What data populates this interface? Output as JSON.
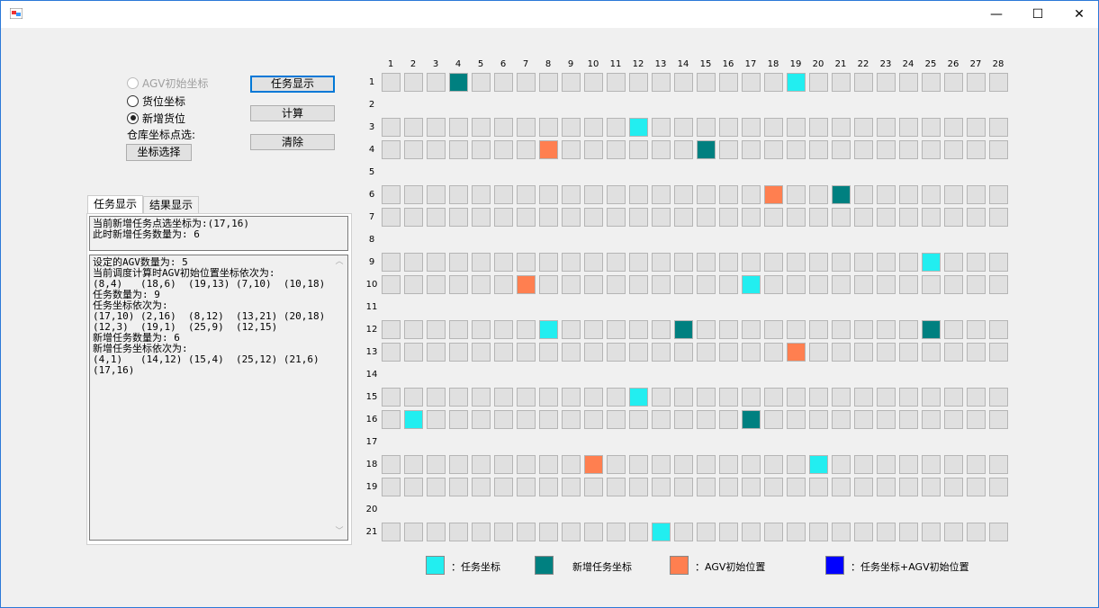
{
  "window": {
    "minimize": "—",
    "maximize": "☐",
    "close": "✕"
  },
  "controls": {
    "radio_agv": "AGV初始坐标",
    "radio_slot": "货位坐标",
    "radio_new": "新增货位",
    "warehouse_label": "仓库坐标点选:",
    "coord_select": "坐标选择",
    "btn_show": "任务显示",
    "btn_calc": "计算",
    "btn_clear": "清除"
  },
  "tabs": [
    "任务显示",
    "结果显示"
  ],
  "info_text": "当前新增任务点选坐标为:(17,16)\n此时新增任务数量为: 6",
  "log_text": "设定的AGV数量为: 5\n当前调度计算时AGV初始位置坐标依次为:\n(8,4)   (18,6)  (19,13) (7,10)  (10,18)\n任务数量为: 9\n任务坐标依次为:\n(17,10) (2,16)  (8,12)  (13,21) (20,18)\n(12,3)  (19,1)  (25,9)  (12,15)\n新增任务数量为: 6\n新增任务坐标依次为:\n(4,1)   (14,12) (15,4)  (25,12) (21,6)\n(17,16)",
  "grid": {
    "cols": 28,
    "rows": 21,
    "empty_rows": [
      2,
      5,
      8,
      11,
      14,
      17,
      20
    ],
    "colors": {
      "task": "#22eef0",
      "new_task": "#008080",
      "agv": "#ff7f50",
      "task_agv": "#0000ff"
    },
    "task": [
      [
        19,
        1
      ],
      [
        12,
        3
      ],
      [
        25,
        9
      ],
      [
        17,
        10
      ],
      [
        8,
        12
      ],
      [
        12,
        15
      ],
      [
        2,
        16
      ],
      [
        20,
        18
      ],
      [
        13,
        21
      ]
    ],
    "new_task": [
      [
        4,
        1
      ],
      [
        15,
        4
      ],
      [
        21,
        6
      ],
      [
        14,
        12
      ],
      [
        25,
        12
      ],
      [
        17,
        16
      ]
    ],
    "agv": [
      [
        8,
        4
      ],
      [
        18,
        6
      ],
      [
        7,
        10
      ],
      [
        19,
        13
      ],
      [
        10,
        18
      ]
    ]
  },
  "legend": [
    {
      "key": "task",
      "label": "：任务坐标"
    },
    {
      "key": "new_task",
      "label": "新增任务坐标"
    },
    {
      "key": "agv",
      "label": "：AGV初始位置"
    },
    {
      "key": "task_agv",
      "label": "：任务坐标+AGV初始位置"
    }
  ]
}
